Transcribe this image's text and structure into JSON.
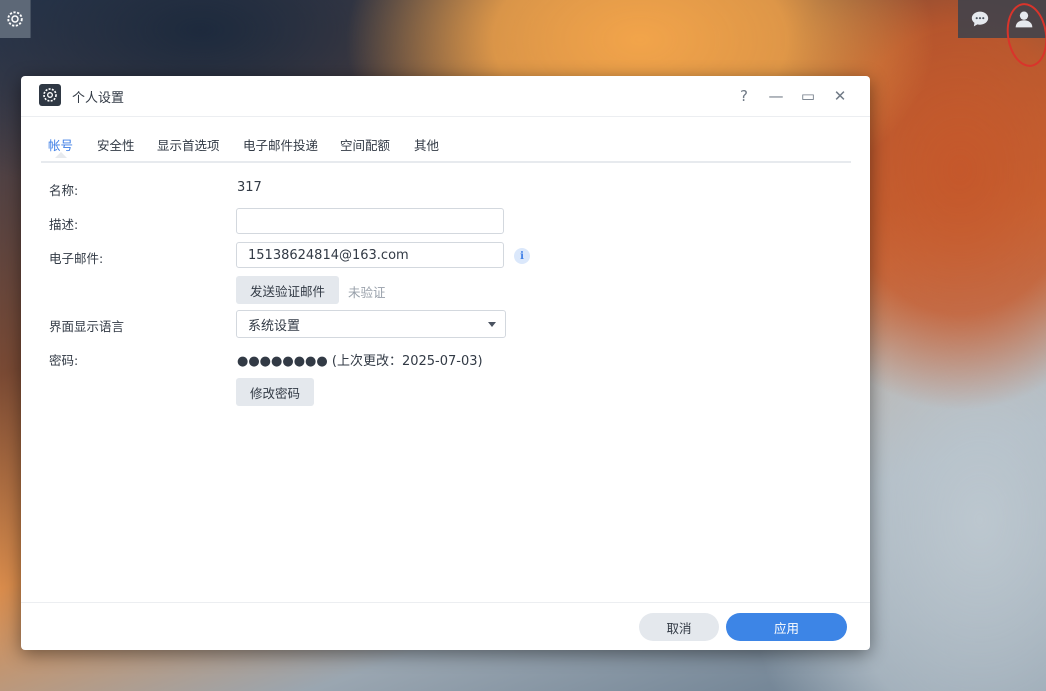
{
  "desktop": {
    "settings_icon": "gear-icon",
    "topbar_icons": [
      "chat-icon",
      "user-icon"
    ]
  },
  "window": {
    "title": "个人设置",
    "icon": "gear-icon",
    "controls": {
      "help": "?",
      "minimize": "—",
      "maximize": "▭",
      "close": "✕"
    }
  },
  "tabs": [
    {
      "label": "帐号",
      "active": true
    },
    {
      "label": "安全性"
    },
    {
      "label": "显示首选项"
    },
    {
      "label": "电子邮件投递"
    },
    {
      "label": "空间配额"
    },
    {
      "label": "其他"
    }
  ],
  "form": {
    "name_label": "名称:",
    "name_value": "317",
    "description_label": "描述:",
    "description_value": "",
    "email_label": "电子邮件:",
    "email_value": "15138624814@163.com",
    "email_info_icon": "info-icon",
    "send_verify_label": "发送验证邮件",
    "verify_status": "未验证",
    "language_label": "界面显示语言",
    "language_value": "系统设置",
    "password_label": "密码:",
    "password_value": "●●●●●●●● (上次更改：2025-07-03)",
    "change_password_label": "修改密码"
  },
  "footer": {
    "cancel_label": "取消",
    "apply_label": "应用"
  },
  "colors": {
    "accent": "#3d85e6",
    "annotation": "#d9342b"
  }
}
